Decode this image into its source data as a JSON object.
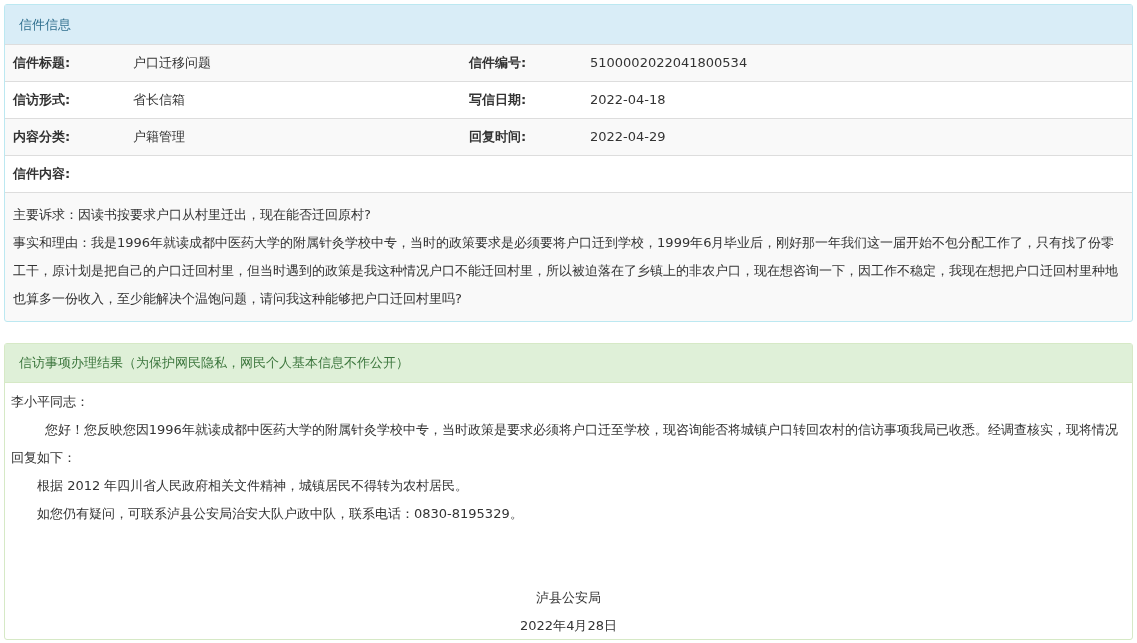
{
  "letter_panel": {
    "title": "信件信息",
    "fields": [
      {
        "label": "信件标题:",
        "value": "户口迁移问题",
        "label_2": "信件编号:",
        "value_2": "5100002022041800534"
      },
      {
        "label": "信访形式:",
        "value": "省长信箱",
        "label_2": "写信日期:",
        "value_2": "2022-04-18"
      },
      {
        "label": "内容分类:",
        "value": "户籍管理",
        "label_2": "回复时间:",
        "value_2": "2022-04-29"
      }
    ],
    "content_label": "信件内容:",
    "content": [
      "主要诉求：因读书按要求户口从村里迁出，现在能否迁回原村?",
      "事实和理由：我是1996年就读成都中医药大学的附属针灸学校中专，当时的政策要求是必须要将户口迁到学校，1999年6月毕业后，刚好那一年我们这一届开始不包分配工作了，只有找了份零工干，原计划是把自己的户口迁回村里，但当时遇到的政策是我这种情况户口不能迁回村里，所以被迫落在了乡镇上的非农户口，现在想咨询一下，因工作不稳定，我现在想把户口迁回村里种地也算多一份收入，至少能解决个温饱问题，请问我这种能够把户口迁回村里吗?"
    ]
  },
  "result_panel": {
    "title": "信访事项办理结果（为保护网民隐私，网民个人基本信息不作公开）",
    "salutation": "李小平同志：",
    "paragraphs": [
      "您好！您反映您因1996年就读成都中医药大学的附属针灸学校中专，当时政策是要求必须将户口迁至学校，现咨询能否将城镇户口转回农村的信访事项我局已收悉。经调查核实，现将情况回复如下：",
      "根据 2012 年四川省人民政府相关文件精神，城镇居民不得转为农村居民。",
      "如您仍有疑问，可联系泸县公安局治安大队户政中队，联系电话：0830-8195329。"
    ],
    "signature": "泸县公安局",
    "date": "2022年4月28日"
  }
}
